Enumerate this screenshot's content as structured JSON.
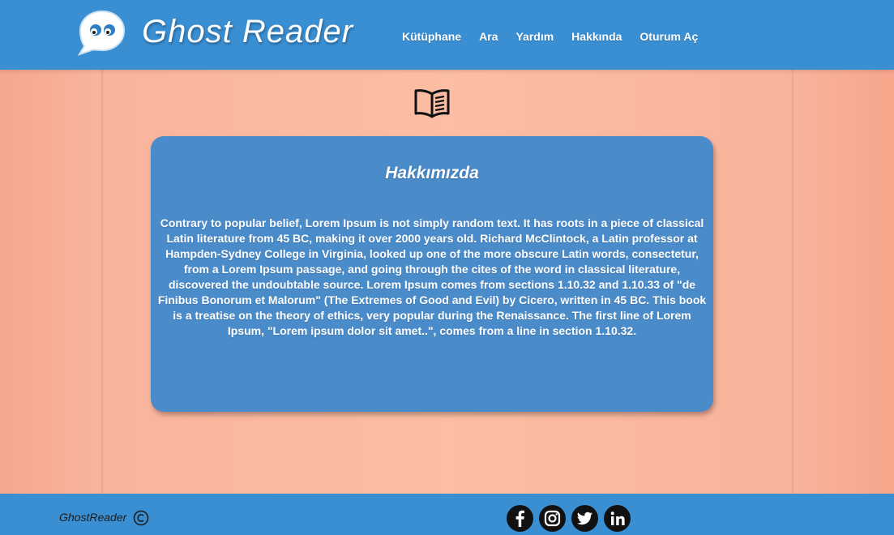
{
  "header": {
    "brand": "Ghost Reader",
    "nav": [
      {
        "label": "Kütüphane"
      },
      {
        "label": "Ara"
      },
      {
        "label": "Yardım"
      },
      {
        "label": "Hakkında"
      },
      {
        "label": "Oturum Aç"
      }
    ]
  },
  "main": {
    "icon": "open-book-icon",
    "card": {
      "title": "Hakkımızda",
      "text": "Contrary to popular belief, Lorem Ipsum is not simply random text. It has roots in a piece of classical Latin literature from 45 BC, making it over 2000 years old. Richard McClintock, a Latin professor at Hampden-Sydney College in Virginia, looked up one of the more obscure Latin words, consectetur, from a Lorem Ipsum passage, and going through the cites of the word in classical literature, discovered the undoubtable source. Lorem Ipsum comes from sections 1.10.32 and 1.10.33 of \"de Finibus Bonorum et Malorum\" (The Extremes of Good and Evil) by Cicero, written in 45 BC. This book is a treatise on the theory of ethics, very popular during the Renaissance. The first line of Lorem Ipsum, \"Lorem ipsum dolor sit amet..\", comes from a line in section 1.10.32."
    }
  },
  "footer": {
    "brand": "GhostReader",
    "copyright_icon": "copyright-icon",
    "socials": [
      "facebook-icon",
      "instagram-icon",
      "twitter-icon",
      "linkedin-icon"
    ]
  },
  "colors": {
    "header_bg": "#3a8fd3",
    "card_bg": "#4a8bca",
    "page_bg": "#fbbda3",
    "social_bg": "#111111"
  }
}
